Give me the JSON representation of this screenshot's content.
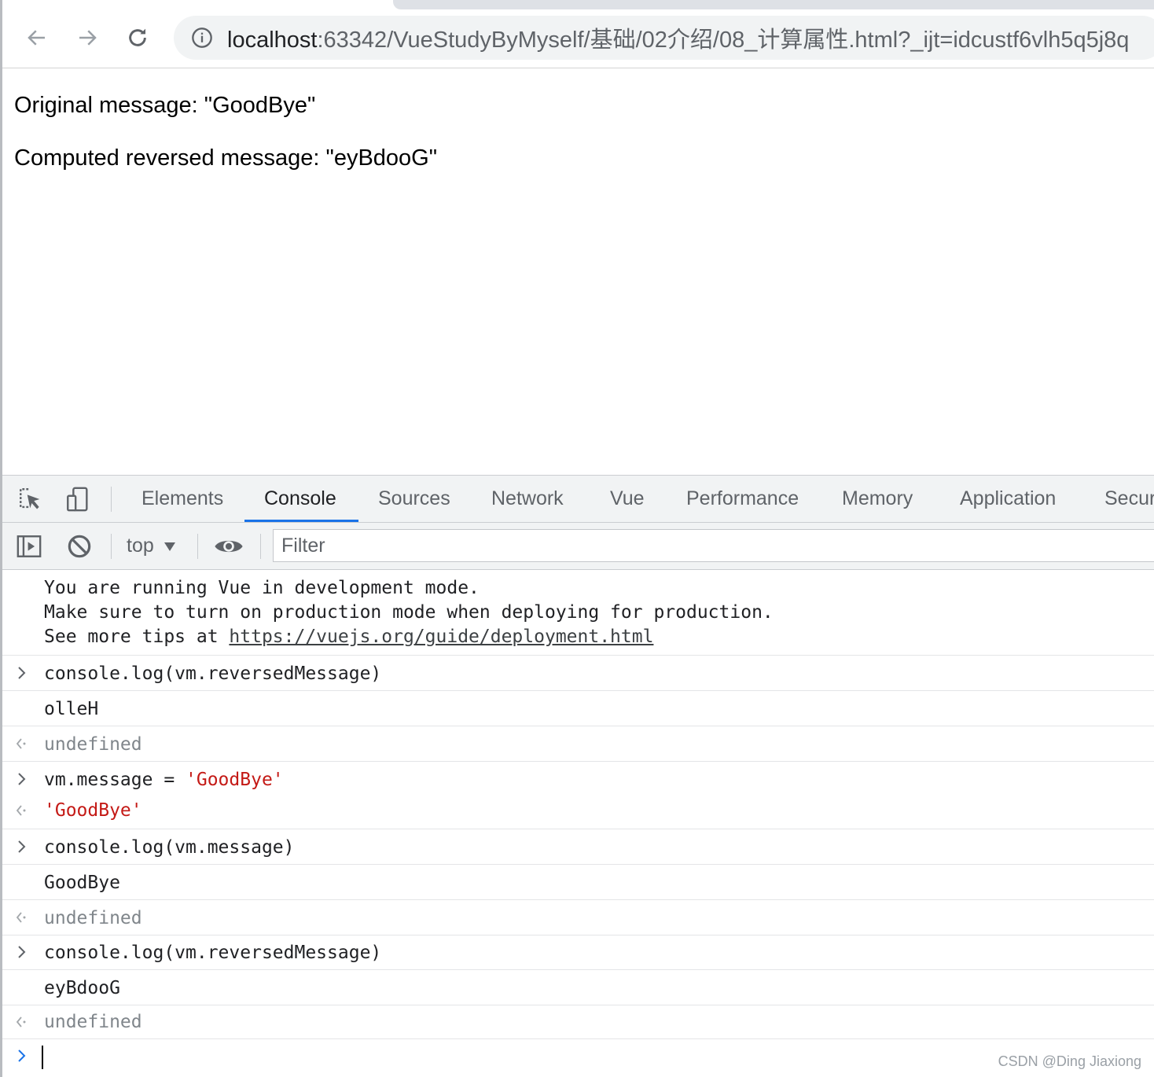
{
  "browser": {
    "url_host": "localhost",
    "url_rest": ":63342/VueStudyByMyself/基础/02介绍/08_计算属性.html?_ijt=idcustf6vlh5q5j8q",
    "icons": {
      "back": "arrow-left-icon",
      "forward": "arrow-right-icon",
      "reload": "reload-icon",
      "site_info": "info-icon"
    }
  },
  "page": {
    "original": "Original message: \"GoodBye\"",
    "computed": "Computed reversed message: \"eyBdooG\""
  },
  "devtools": {
    "tabs": [
      {
        "label": "Elements"
      },
      {
        "label": "Console"
      },
      {
        "label": "Sources"
      },
      {
        "label": "Network"
      },
      {
        "label": "Vue"
      },
      {
        "label": "Performance"
      },
      {
        "label": "Memory"
      },
      {
        "label": "Application"
      },
      {
        "label": "Secur"
      }
    ],
    "active_tab": "Console",
    "accent_color": "#1a73e8",
    "console_toolbar": {
      "context": "top",
      "filter_placeholder": "Filter"
    },
    "messages": {
      "vue_notice": {
        "line1": "You are running Vue in development mode.",
        "line2": "Make sure to turn on production mode when deploying for production.",
        "line3_prefix": "See more tips at ",
        "line3_link": "https://vuejs.org/guide/deployment.html"
      },
      "cmd1": "console.log(vm.reversedMessage)",
      "out1": "olleH",
      "ret1": "undefined",
      "cmd2_code": "vm.message = ",
      "cmd2_str": "'GoodBye'",
      "ret2": "'GoodBye'",
      "cmd3": "console.log(vm.message)",
      "out3": "GoodBye",
      "ret3": "undefined",
      "cmd4": "console.log(vm.reversedMessage)",
      "out4": "eyBdooG",
      "ret4": "undefined"
    },
    "string_color": "#c41a16"
  },
  "watermark": "CSDN @Ding Jiaxiong"
}
